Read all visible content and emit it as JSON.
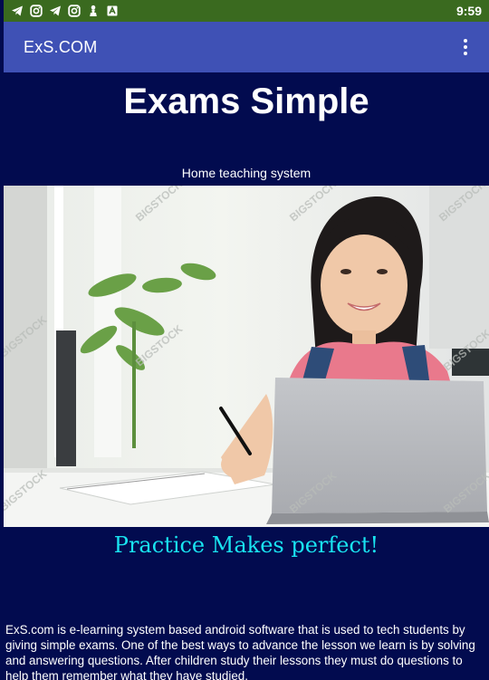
{
  "status_bar": {
    "time": "9:59",
    "icons": [
      "telegram-icon",
      "instagram-icon",
      "telegram-icon",
      "instagram-icon",
      "pawn-icon",
      "news-icon"
    ]
  },
  "app_bar": {
    "title": "ExS.COM",
    "menu_icon": "more-vert-icon"
  },
  "hero": {
    "title": "Exams Simple",
    "subtitle": "Home teaching system",
    "watermark": "BIGSTOCK"
  },
  "tagline": "Practice Makes perfect!",
  "description": "ExS.com is e-learning system based android software that is used to tech students by giving simple exams. One of the best ways to advance the lesson we learn is by solving and answering questions. After children study their lessons they must do questions to help them remember what they have studied.",
  "colors": {
    "status_bar": "#3a6a1f",
    "app_bar": "#3f51b5",
    "background": "#020b4f",
    "tagline": "#19e3f0"
  }
}
